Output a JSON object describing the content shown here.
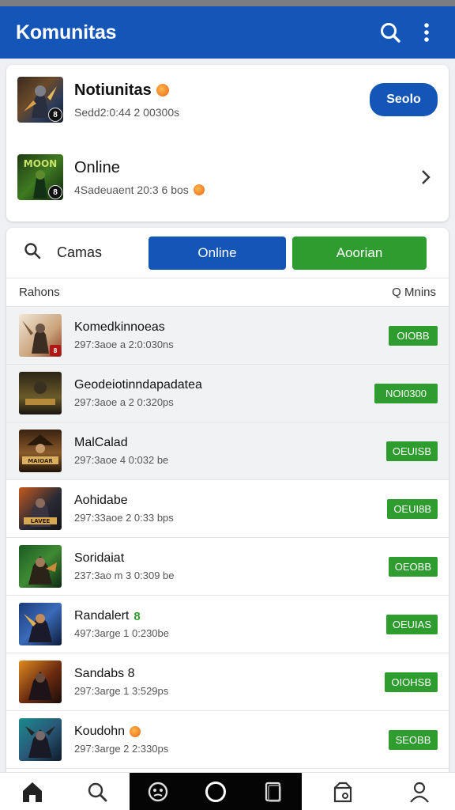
{
  "appbar": {
    "title": "Komunitas"
  },
  "featured": [
    {
      "title": "Notiunitas",
      "subtitle": "Sedd2:0:44 2 00300s",
      "action": "Seolo"
    },
    {
      "title": "Online",
      "subtitle": "4Sadeuaent 20:3 6 bos"
    }
  ],
  "filter": {
    "label": "Camas",
    "btn_online": "Online",
    "btn_secondary": "Aoorian"
  },
  "list_header": {
    "left": "Rahons",
    "right": "Q Mnins"
  },
  "items": [
    {
      "title": "Komedkinnoeas",
      "subtitle": "297:3aoe a 2:0:030ns",
      "badge": "OIOBB"
    },
    {
      "title": "Geodeiotinndapadatea",
      "subtitle": "297:3aoe a 2 0:320ps",
      "badge": "NOI0300"
    },
    {
      "title": "MalCalad",
      "subtitle": "297:3aoe 4 0:032 be",
      "badge": "OEUISB"
    },
    {
      "title": "Aohidabe",
      "subtitle": "297:33aoe 2 0:33 bps",
      "badge": "OEUI8B"
    },
    {
      "title": "Soridaiat",
      "subtitle": "237:3ao m 3 0:309 be",
      "badge": "OEOBB"
    },
    {
      "title": "Randalert",
      "title_num": "8",
      "subtitle": "497:3arge 1 0:230be",
      "badge": "OEUIAS"
    },
    {
      "title": "Sandabs 8",
      "subtitle": "297:3arge 1 3:529ps",
      "badge": "OIOHSB"
    },
    {
      "title": "Koudohn",
      "subtitle": "297:3arge 2 2:330ps",
      "badge": "SEOBB"
    }
  ],
  "thumb_labels": {
    "f1": "8",
    "f2_text": "MOON",
    "f2_badge": "8",
    "i1": "8",
    "i3": "MAIOAR",
    "i4": "LAVEE"
  },
  "colors": {
    "primary": "#1456b8",
    "success": "#2f9c30",
    "accent": "#e8651a"
  },
  "icons": {
    "appbar": [
      "search-icon",
      "more-vert-icon"
    ],
    "nav": [
      "home-icon",
      "search-icon",
      "game-controller-icon",
      "circle-icon",
      "tablet-icon",
      "store-icon",
      "profile-icon"
    ]
  }
}
